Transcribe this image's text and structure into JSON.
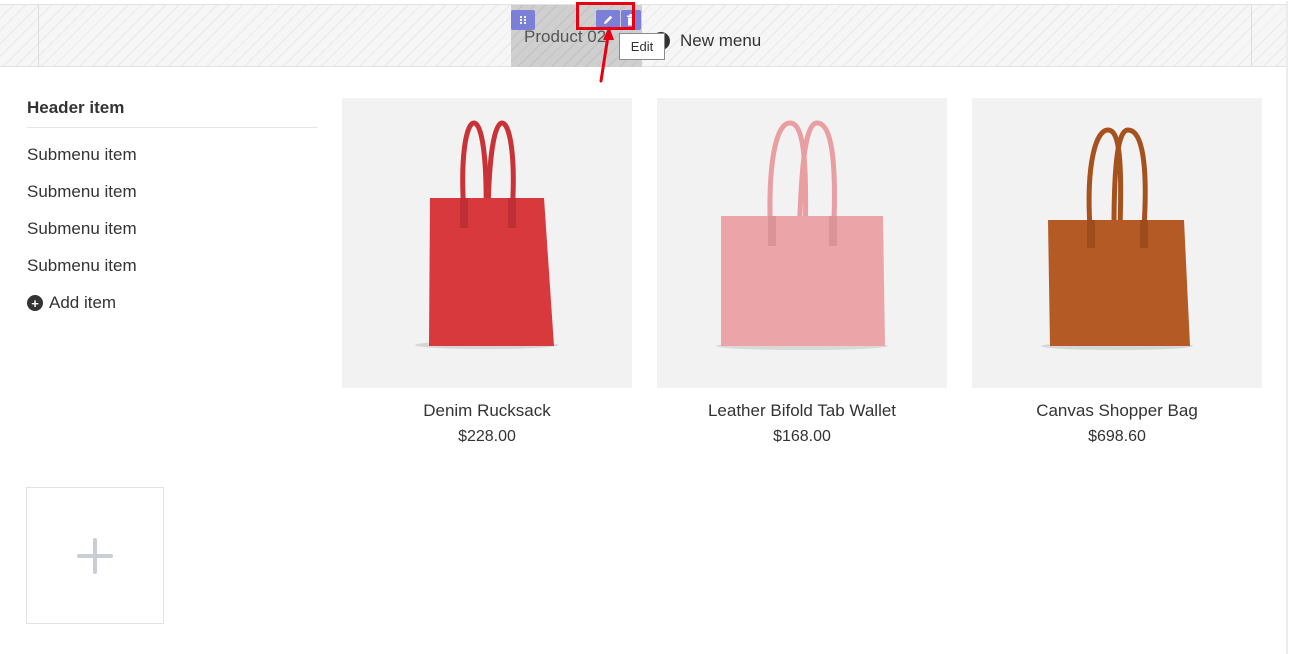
{
  "menubar": {
    "product_item_label": "Product 02",
    "new_menu_label": "New menu",
    "tooltip": "Edit",
    "icons": {
      "handle": "drag-handle-icon",
      "edit": "pencil-icon",
      "delete": "trash-icon",
      "new_menu": "plus-circle-icon"
    }
  },
  "submenu": {
    "header": "Header item",
    "items": [
      "Submenu item",
      "Submenu item",
      "Submenu item",
      "Submenu item"
    ],
    "add_label": "Add item"
  },
  "products": [
    {
      "name": "Denim Rucksack",
      "price": "$228.00",
      "color": "#d8393c",
      "strap": "#c93236"
    },
    {
      "name": "Leather Bifold Tab Wallet",
      "price": "$168.00",
      "color": "#eba5a8",
      "strap": "#e99ea2"
    },
    {
      "name": "Canvas Shopper Bag",
      "price": "$698.60",
      "color": "#b35a25",
      "strap": "#a5521f"
    }
  ],
  "colors": {
    "accent": "#7b7fd8",
    "highlight": "#e60012"
  }
}
